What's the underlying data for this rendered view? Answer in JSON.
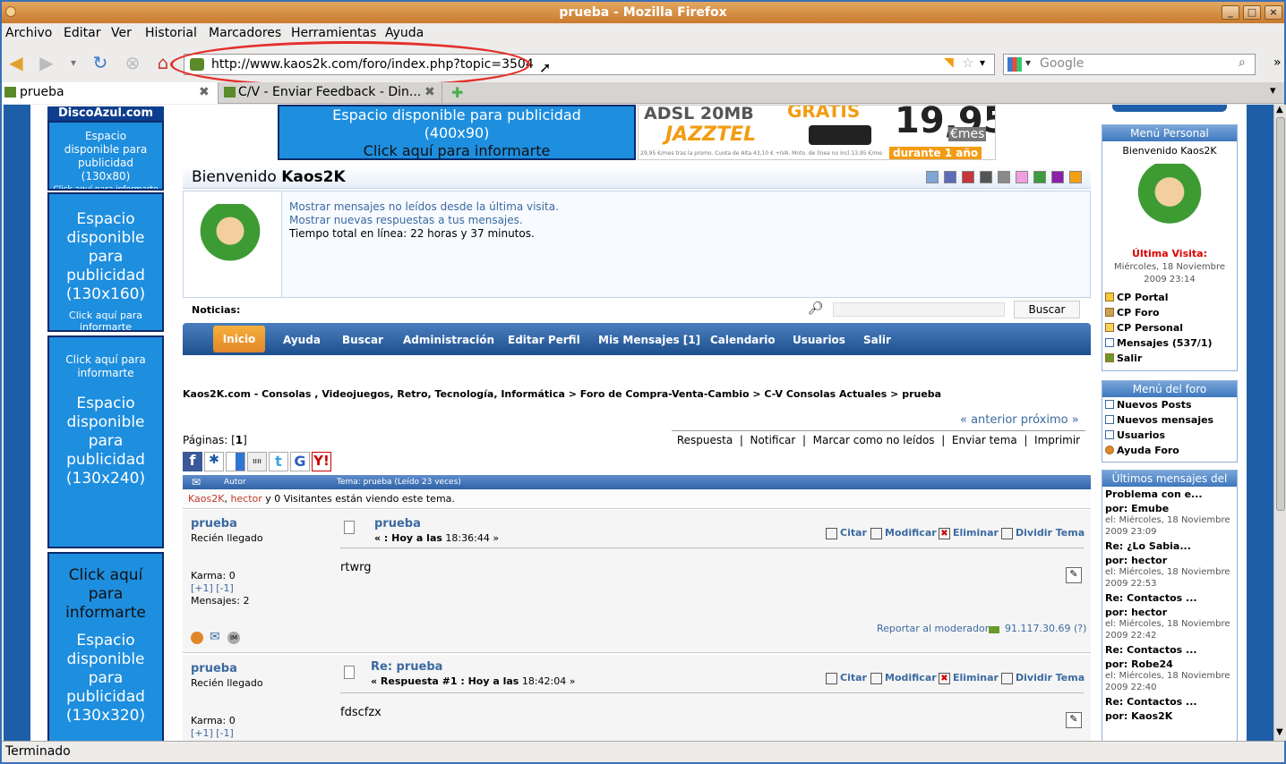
{
  "window": {
    "title": "prueba - Mozilla Firefox"
  },
  "menu": [
    "Archivo",
    "Editar",
    "Ver",
    "Historial",
    "Marcadores",
    "Herramientas",
    "Ayuda"
  ],
  "navbar": {
    "url": "http://www.kaos2k.com/foro/index.php?topic=3504",
    "search_placeholder": "Google"
  },
  "tabs": [
    {
      "label": "prueba"
    },
    {
      "label": "C/V - Enviar Feedback - Din..."
    }
  ],
  "status": "Terminado",
  "ads": {
    "top_logo": "DiscoAzul.com",
    "ad80": {
      "line1": "Espacio disponible para publicidad",
      "line2": "(130x80)",
      "line3": "Click aquí para informarte"
    },
    "ad160": {
      "line1": "Espacio disponible para publicidad",
      "line2": "(130x160)",
      "line3": "Click aquí para informarte"
    },
    "ad240": {
      "line0": "Click aquí para informarte",
      "line1": "Espacio disponible para publicidad",
      "line2": "(130x240)"
    },
    "ad320": {
      "line0": "Click aquí para informarte",
      "line1": "Espacio disponible para publicidad",
      "line2": "(130x320)"
    },
    "banner400": {
      "line1": "Espacio disponible para publicidad",
      "line2": "(400x90)",
      "line3": "Click aquí para informarte"
    },
    "jazztel": {
      "brand": "JAZZTEL",
      "adsl": "ADSL 20MB",
      "price": "19,95",
      "unit": "€mes",
      "promo": "durante 1 año",
      "gratis": "GRATIS",
      "fine": "29,95 €/mes tras la promo. Cuota de Alta 43,10 € +IVA. Mnto. de línea no incl.13,95 €/mes"
    }
  },
  "welcome": {
    "prefix": "Bienvenido",
    "user": "Kaos2K",
    "link1": "Mostrar mensajes no leídos desde la última visita.",
    "link2": "Mostrar nuevas respuestas a tus mensajes.",
    "online": "Tiempo total en línea: 22 horas y 37 minutos.",
    "color_swatches": [
      "#7fa6d6",
      "#5d6bb8",
      "#c7343a",
      "#555555",
      "#8a8a8a",
      "#f0a0e0",
      "#3e9a3e",
      "#8a1fa8",
      "#f5a010"
    ]
  },
  "noticias": {
    "label": "Noticias:",
    "button": "Buscar"
  },
  "navtabs": [
    "Inicio",
    "Ayuda",
    "Buscar",
    "Administración",
    "Editar Perfil",
    "Mis Mensajes [1]",
    "Calendario",
    "Usuarios",
    "Salir"
  ],
  "breadcrumb": "Kaos2K.com - Consolas , Videojuegos, Retro, Tecnología, Informática > Foro de Compra-Venta-Cambio > C-V Consolas Actuales > prueba",
  "prevnext": "« anterior próximo »",
  "pages": {
    "label": "Páginas:",
    "current": "1"
  },
  "actions": [
    "Respuesta",
    "Notificar",
    "Marcar como no leídos",
    "Enviar tema",
    "Imprimir"
  ],
  "thread_header": {
    "autor": "Autor",
    "tema": "Tema: prueba  (Leído 23 veces)"
  },
  "viewing": {
    "u1": "Kaos2K",
    "u2": "hector",
    "rest": " y 0 Visitantes están viendo este tema."
  },
  "posts": [
    {
      "author": "prueba",
      "rank": "Recién llegado",
      "karma": "Karma: 0",
      "karma_links": "[+1] [-1]",
      "msgs": "Mensajes: 2",
      "subject": "prueba",
      "date_prefix": "« : Hoy a las",
      "date": " 18:36:44 »",
      "body": "rtwrg",
      "report": "Reportar al moderador",
      "ip": "91.117.30.69 (?)"
    },
    {
      "author": "prueba",
      "rank": "Recién llegado",
      "karma": "Karma: 0",
      "karma_links": "[+1] [-1]",
      "subject": "Re: prueba",
      "date_prefix": "« Respuesta #1 : Hoy a las",
      "date": " 18:42:04 »",
      "body": "fdscfzx"
    }
  ],
  "post_tools": [
    "Citar",
    "Modificar",
    "Eliminar",
    "Dividir Tema"
  ],
  "menu_personal": {
    "title": "Menú Personal",
    "welcome": "Bienvenido Kaos2K",
    "last_visit_label": "Última Visita:",
    "last_visit": "Miércoles, 18 Noviembre 2009 23:14",
    "items": [
      "CP Portal",
      "CP Foro",
      "CP Personal",
      "Mensajes (537/1)",
      "Salir"
    ]
  },
  "menu_foro": {
    "title": "Menú del foro",
    "items": [
      "Nuevos Posts",
      "Nuevos mensajes",
      "Usuarios",
      "Ayuda Foro"
    ]
  },
  "ultimos": {
    "title": "Últimos mensajes del foro",
    "items": [
      {
        "t": "Problema con e...",
        "by": "por: Emube",
        "date": "el: Miércoles, 18 Noviembre 2009 23:09"
      },
      {
        "t": "Re: ¿Lo Sabia...",
        "by": "por: hector",
        "date": "el: Miércoles, 18 Noviembre 2009 22:53"
      },
      {
        "t": "Re: Contactos ...",
        "by": "por: hector",
        "date": "el: Miércoles, 18 Noviembre 2009 22:42"
      },
      {
        "t": "Re: Contactos ...",
        "by": "por: Robe24",
        "date": "el: Miércoles, 18 Noviembre 2009 22:40"
      },
      {
        "t": "Re: Contactos ...",
        "by": "por: Kaos2K",
        "date": ""
      }
    ]
  }
}
